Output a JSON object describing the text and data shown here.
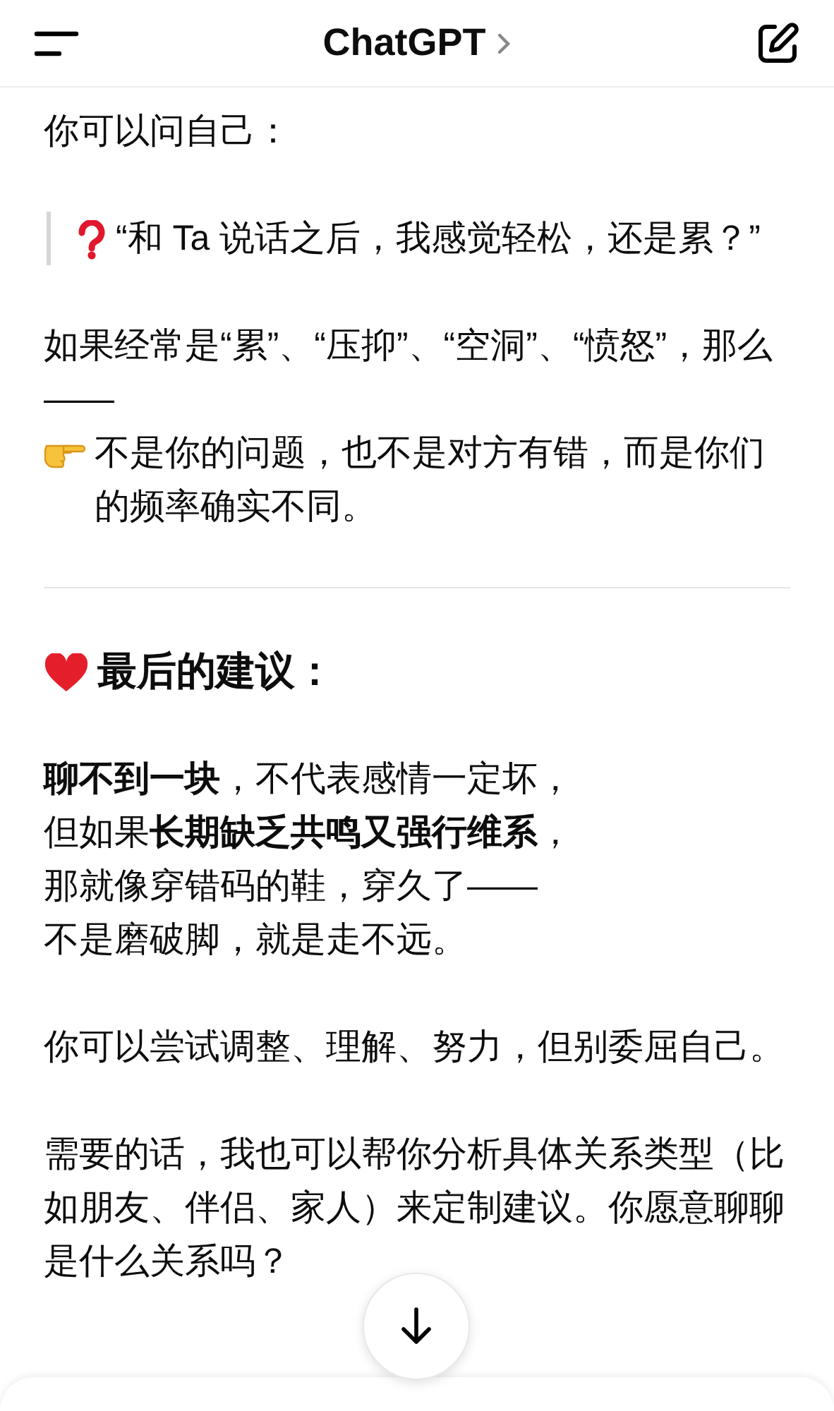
{
  "header": {
    "title": "ChatGPT"
  },
  "blocks": [
    {
      "kind": "paragraph",
      "lines": [
        {
          "text": "你可以问自己："
        }
      ]
    },
    {
      "kind": "quote",
      "lines": [
        {
          "kind": "question",
          "text": "“和 Ta 说话之后，我感觉轻松，还是累？”"
        }
      ]
    },
    {
      "kind": "paragraph",
      "lines": [
        {
          "text": "如果经常是“累”、“压抑”、“空洞”、“愤怒”，那么——"
        },
        {
          "kind": "pointer",
          "text": "不是你的问题，也不是对方有错，而是你们的频率确实不同。"
        }
      ]
    },
    {
      "kind": "divider"
    },
    {
      "kind": "heading",
      "lines": [
        {
          "kind": "heart",
          "text": "最后的建议："
        }
      ]
    },
    {
      "kind": "paragraph",
      "lines": [
        {
          "text": "**聊不到一块**，不代表感情一定坏，"
        },
        {
          "text": "但如果**长期缺乏共鸣又强行维系**，"
        },
        {
          "text": "那就像穿错码的鞋，穿久了——"
        },
        {
          "text": "不是磨破脚，就是走不远。"
        }
      ]
    },
    {
      "kind": "paragraph",
      "lines": [
        {
          "text": "你可以尝试调整、理解、努力，但别委屈自己。"
        }
      ]
    },
    {
      "kind": "paragraph",
      "lines": [
        {
          "text": "需要的话，我也可以帮你分析具体关系类型（比如朋友、伴侣、家人）来定制建议。你愿意聊聊是什么关系吗？"
        }
      ]
    }
  ]
}
